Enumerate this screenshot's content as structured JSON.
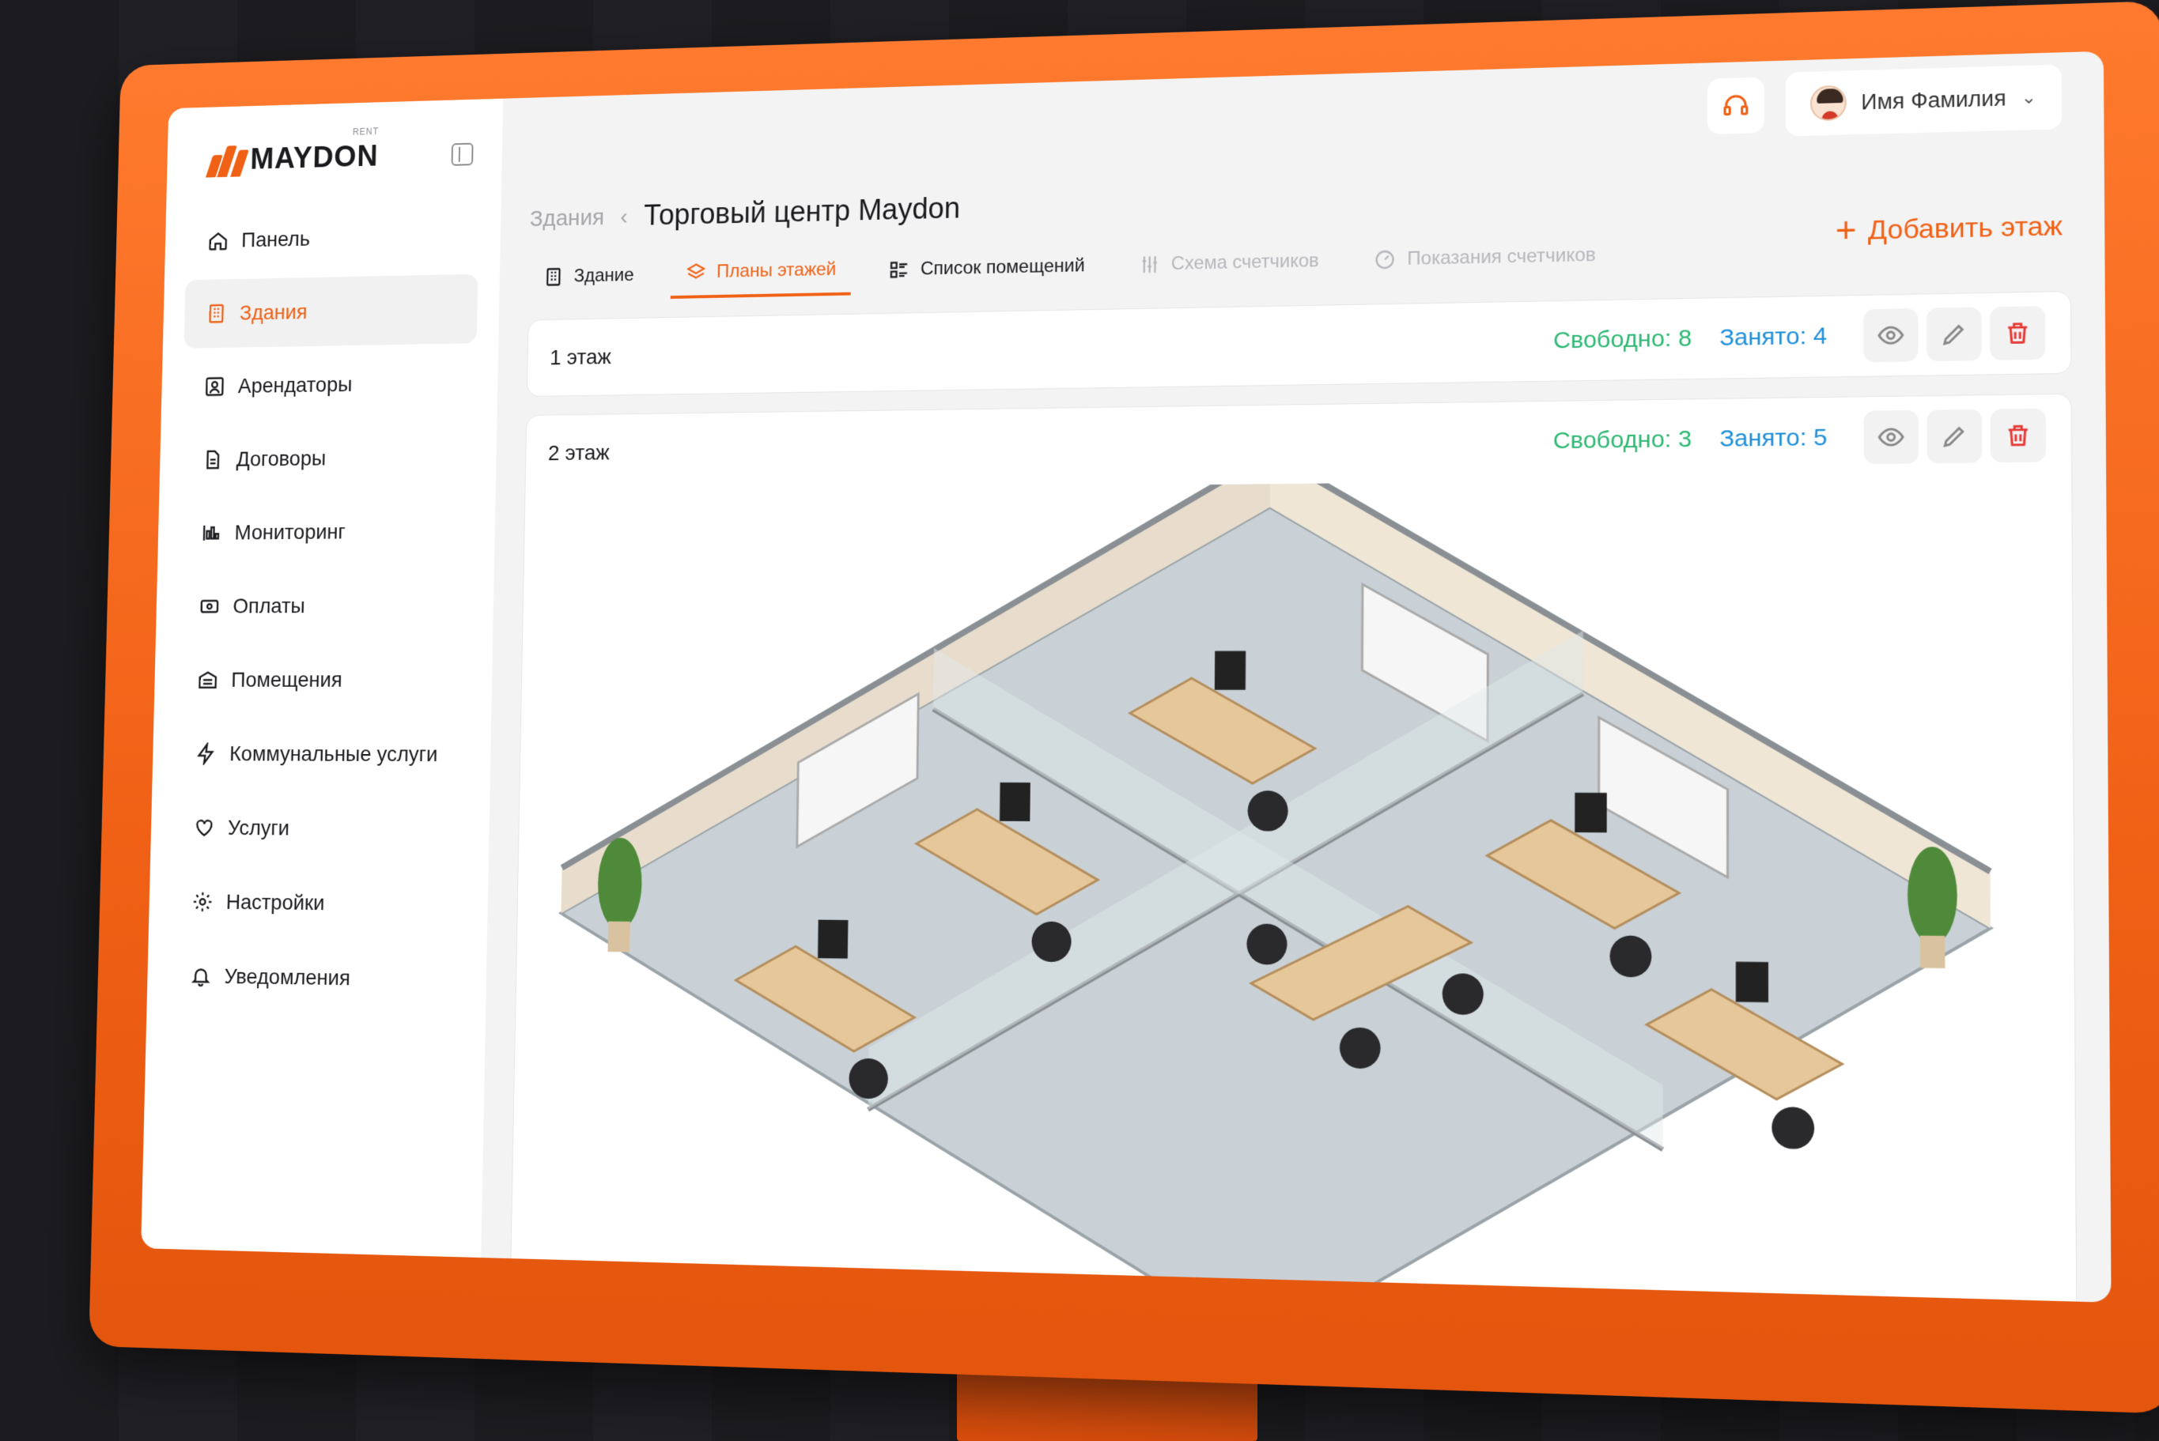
{
  "app": {
    "logo_text": "MAYDON",
    "logo_sub": "RENT",
    "brand_color": "#f06116"
  },
  "sidebar": {
    "items": [
      {
        "label": "Панель",
        "icon": "home-icon",
        "active": false
      },
      {
        "label": "Здания",
        "icon": "building-icon",
        "active": true
      },
      {
        "label": "Арендаторы",
        "icon": "tenant-icon",
        "active": false
      },
      {
        "label": "Договоры",
        "icon": "document-icon",
        "active": false
      },
      {
        "label": "Мониторинг",
        "icon": "chart-icon",
        "active": false
      },
      {
        "label": "Оплаты",
        "icon": "payment-icon",
        "active": false
      },
      {
        "label": "Помещения",
        "icon": "rooms-icon",
        "active": false
      },
      {
        "label": "Коммунальные услуги",
        "icon": "lightning-icon",
        "active": false
      },
      {
        "label": "Услуги",
        "icon": "heart-hand-icon",
        "active": false
      },
      {
        "label": "Настройки",
        "icon": "gear-icon",
        "active": false
      },
      {
        "label": "Уведомления",
        "icon": "bell-icon",
        "active": false
      }
    ]
  },
  "topbar": {
    "user_name": "Имя Фамилия"
  },
  "breadcrumb": {
    "parent": "Здания",
    "current": "Торговый центр Maydon"
  },
  "tabs": [
    {
      "label": "Здание",
      "icon": "building-icon",
      "state": "normal"
    },
    {
      "label": "Планы этажей",
      "icon": "layers-icon",
      "state": "active"
    },
    {
      "label": "Список помещений",
      "icon": "list-icon",
      "state": "normal"
    },
    {
      "label": "Схема счетчиков",
      "icon": "sliders-icon",
      "state": "disabled"
    },
    {
      "label": "Показания счетчиков",
      "icon": "gauge-icon",
      "state": "disabled"
    }
  ],
  "actions": {
    "add_floor": "Добавить этаж"
  },
  "floors": [
    {
      "name": "1 этаж",
      "free": "Свободно: 8",
      "busy": "Занято: 4"
    },
    {
      "name": "2 этаж",
      "free": "Свободно: 3",
      "busy": "Занято: 5"
    }
  ],
  "colors": {
    "free": "#2eb873",
    "busy": "#1f8fd8",
    "delete": "#e53935"
  }
}
